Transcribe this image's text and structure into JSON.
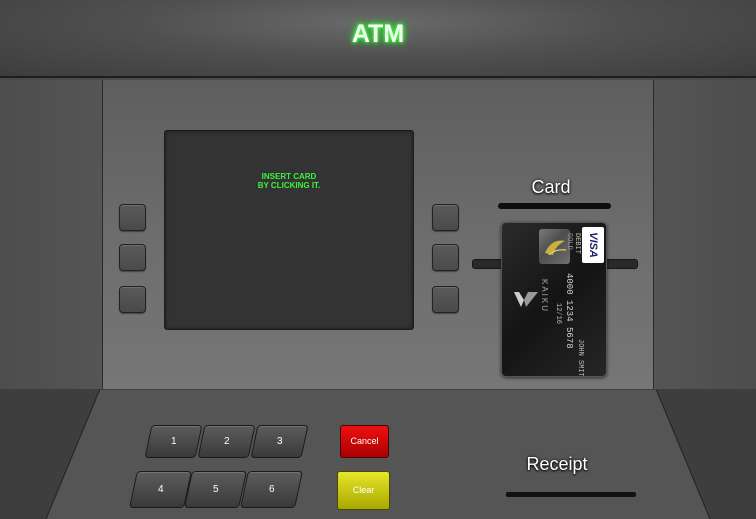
{
  "header": {
    "title": "ATM"
  },
  "screen": {
    "message": "INSERT CARD\nBY CLICKING IT."
  },
  "card_slot": {
    "label": "Card"
  },
  "card": {
    "network": "VISA",
    "type": "DEBIT",
    "tier": "GOLD",
    "brand": "KAIKU",
    "number": "4000 1234 5678",
    "expiry": "12/16",
    "holder": "JOHN SMITH"
  },
  "keypad": {
    "keys": [
      "1",
      "2",
      "3",
      "4",
      "5",
      "6"
    ],
    "cancel_label": "Cancel",
    "clear_label": "Clear"
  },
  "receipt": {
    "label": "Receipt"
  },
  "colors": {
    "screen_text": "#3cf23c",
    "cancel": "#dd1111",
    "clear": "#d4d41a",
    "title_glow": "#3aff3a"
  }
}
